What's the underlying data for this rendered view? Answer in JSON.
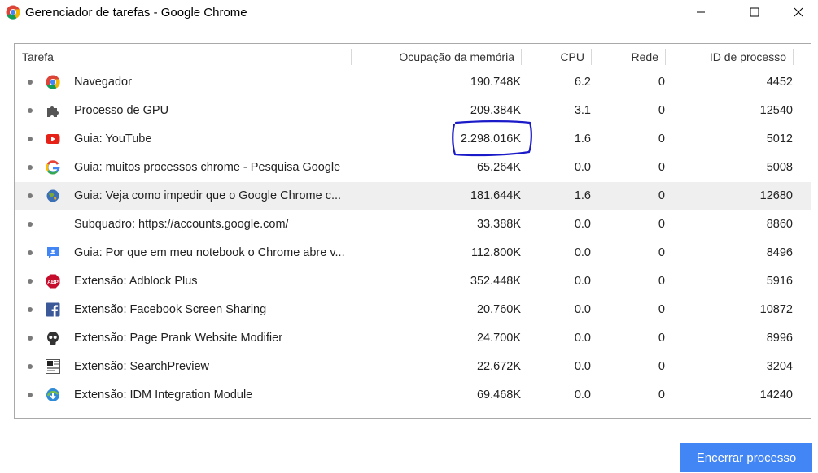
{
  "window": {
    "title": "Gerenciador de tarefas - Google Chrome",
    "controls": [
      "minimize-icon",
      "maximize-icon",
      "close-icon"
    ]
  },
  "table": {
    "columns": [
      "Tarefa",
      "Ocupação da memória",
      "CPU",
      "Rede",
      "ID de processo"
    ],
    "rows": [
      {
        "icon": "chrome-icon",
        "task": "Navegador",
        "memory": "190.748K",
        "cpu": "6.2",
        "network": "0",
        "pid": "4452"
      },
      {
        "icon": "puzzle-icon",
        "task": "Processo de GPU",
        "memory": "209.384K",
        "cpu": "3.1",
        "network": "0",
        "pid": "12540"
      },
      {
        "icon": "youtube-icon",
        "task": "Guia: YouTube",
        "memory": "2.298.016K",
        "cpu": "1.6",
        "network": "0",
        "pid": "5012"
      },
      {
        "icon": "google-icon",
        "task": "Guia: muitos processos chrome - Pesquisa Google",
        "memory": "65.264K",
        "cpu": "0.0",
        "network": "0",
        "pid": "5008"
      },
      {
        "icon": "globe-icon",
        "task": "Guia: Veja como impedir que o Google Chrome c...",
        "memory": "181.644K",
        "cpu": "1.6",
        "network": "0",
        "pid": "12680",
        "selected": true
      },
      {
        "icon": "",
        "task": "Subquadro: https://accounts.google.com/",
        "memory": "33.388K",
        "cpu": "0.0",
        "network": "0",
        "pid": "8860"
      },
      {
        "icon": "support-icon",
        "task": "Guia: Por que em meu notebook o Chrome abre v...",
        "memory": "112.800K",
        "cpu": "0.0",
        "network": "0",
        "pid": "8496"
      },
      {
        "icon": "adblock-icon",
        "task": "Extensão: Adblock Plus",
        "memory": "352.448K",
        "cpu": "0.0",
        "network": "0",
        "pid": "5916"
      },
      {
        "icon": "facebook-icon",
        "task": "Extensão: Facebook Screen Sharing",
        "memory": "20.760K",
        "cpu": "0.0",
        "network": "0",
        "pid": "10872"
      },
      {
        "icon": "skull-icon",
        "task": "Extensão: Page Prank Website Modifier",
        "memory": "24.700K",
        "cpu": "0.0",
        "network": "0",
        "pid": "8996"
      },
      {
        "icon": "searchpreview-icon",
        "task": "Extensão: SearchPreview",
        "memory": "22.672K",
        "cpu": "0.0",
        "network": "0",
        "pid": "3204"
      },
      {
        "icon": "idm-icon",
        "task": "Extensão: IDM Integration Module",
        "memory": "69.468K",
        "cpu": "0.0",
        "network": "0",
        "pid": "14240"
      }
    ]
  },
  "footer": {
    "end_process_label": "Encerrar processo"
  },
  "colors": {
    "accent": "#4285f4",
    "annotation": "#1a1ac8",
    "selected_row": "#efefef"
  }
}
